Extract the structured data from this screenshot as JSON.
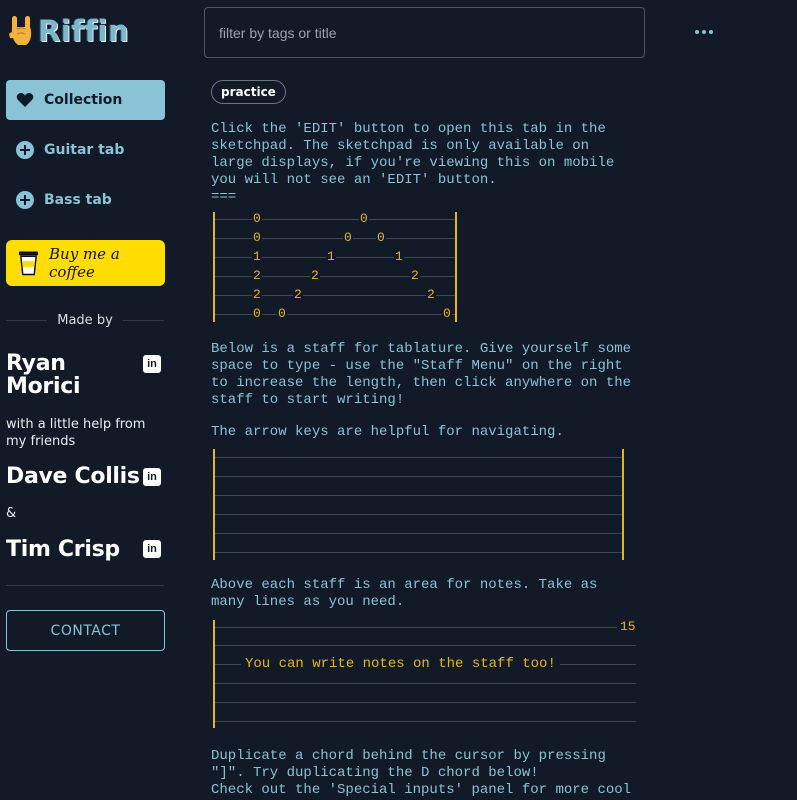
{
  "app": {
    "name": "Riffin"
  },
  "sidebar": {
    "nav": [
      {
        "label": "Collection",
        "icon": "heart-icon",
        "active": true
      },
      {
        "label": "Guitar tab",
        "icon": "plus-circle-icon",
        "active": false
      },
      {
        "label": "Bass tab",
        "icon": "plus-circle-icon",
        "active": false
      }
    ],
    "coffee_label": "Buy me a coffee",
    "made_by": "Made by",
    "authors": [
      "Ryan Morici",
      "Dave Collis",
      "Tim Crisp"
    ],
    "helper_text": "with a little help from my friends",
    "ampersand": "&",
    "contact_label": "CONTACT"
  },
  "header": {
    "search_placeholder": "filter by tags or title",
    "more_icon": "more-horizontal-icon"
  },
  "tab": {
    "tags": [
      "practice"
    ],
    "intro": "Click the 'EDIT' button to open this tab in the\nsketchpad. The sketchpad is only available on\nlarge displays, if you're viewing this on mobile\nyou will not see an 'EDIT' button.\n===",
    "staff1_frets": [
      [
        "0",
        "0"
      ],
      [
        "0",
        "0",
        "0"
      ],
      [
        "1",
        "1",
        "1"
      ],
      [
        "2",
        "2",
        "2"
      ],
      [
        "2",
        "2",
        "2"
      ],
      [
        "0",
        "0",
        "0"
      ]
    ],
    "para2": "Below is a staff for tablature. Give yourself some\nspace to type - use the \"Staff Menu\" on the right\nto increase the length, then click anywhere on the\nstaff to start writing!",
    "para3": "The arrow keys are helpful for navigating.",
    "para4": "Above each staff is an area for notes. Take as\nmany lines as you need.",
    "staff3_number": "15",
    "staff3_note": "You can write notes on the staff too!",
    "para5": "Duplicate a chord behind the cursor by pressing\n\"]\". Try duplicating the D chord below!\nCheck out the 'Special inputs' panel for more cool"
  },
  "colors": {
    "background": "#131a27",
    "accent": "#8ac2d6",
    "tab_yellow": "#e6b422",
    "coffee_yellow": "#ffdd00"
  }
}
